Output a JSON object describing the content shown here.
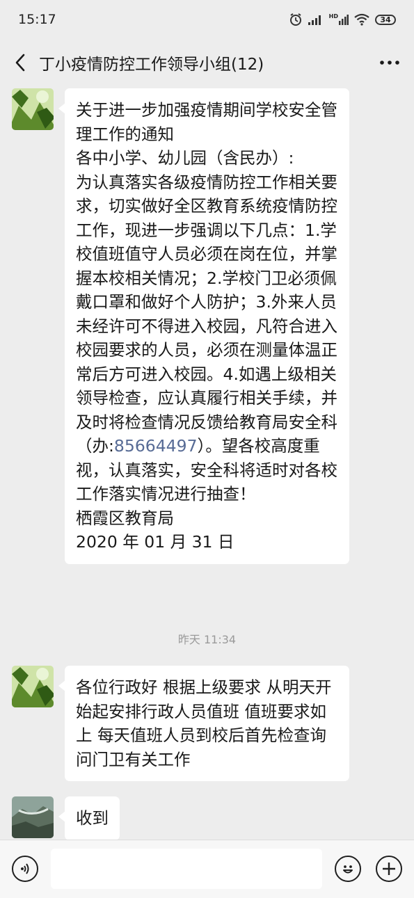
{
  "status_bar": {
    "time": "15:17",
    "signal_hd_label": "HD",
    "battery": "34",
    "icons": [
      "alarm-icon",
      "signal-icon",
      "hd-signal-icon",
      "wifi-icon",
      "battery-icon"
    ]
  },
  "header": {
    "title": "丁小疫情防控工作领导小组(12)",
    "back_icon": "chevron-left-icon",
    "more_icon": "more-icon"
  },
  "messages": [
    {
      "lines": [
        "关于进一步加强疫情期间学校安全管理工作的通知",
        "各中小学、幼儿园（含民办）:",
        "为认真落实各级疫情防控工作相关要求，切实做好全区教育系统疫情防控工作，现进一步强调以下几点：1.学校值班值守人员必须在岗在位，并掌握本校相关情况；2.学校门卫必须佩戴口罩和做好个人防护；3.外来人员未经许可不得进入校园，凡符合进入校园要求的人员，必须在测量体温正常后方可进入校园。4.如遇上级相关领导检查，应认真履行相关手续，并及时将检查情况反馈给教育局安全科（办:",
        "85664497",
        "）。望各校高度重视，认真落实，安全科将适时对各校工作落实情况进行抽查！",
        "栖霞区教育局",
        "2020 年 01 月 31 日"
      ]
    },
    {
      "time_label": "昨天 11:34",
      "text": "各位行政好 根据上级要求 从明天开始起安排行政人员值班 值班要求如上 每天值班人员到校后首先检查询问门卫有关工作"
    },
    {
      "text": "收到"
    }
  ],
  "input_bar": {
    "voice_icon": "voice-icon",
    "emoji_icon": "emoji-icon",
    "plus_icon": "plus-icon",
    "input_value": ""
  }
}
